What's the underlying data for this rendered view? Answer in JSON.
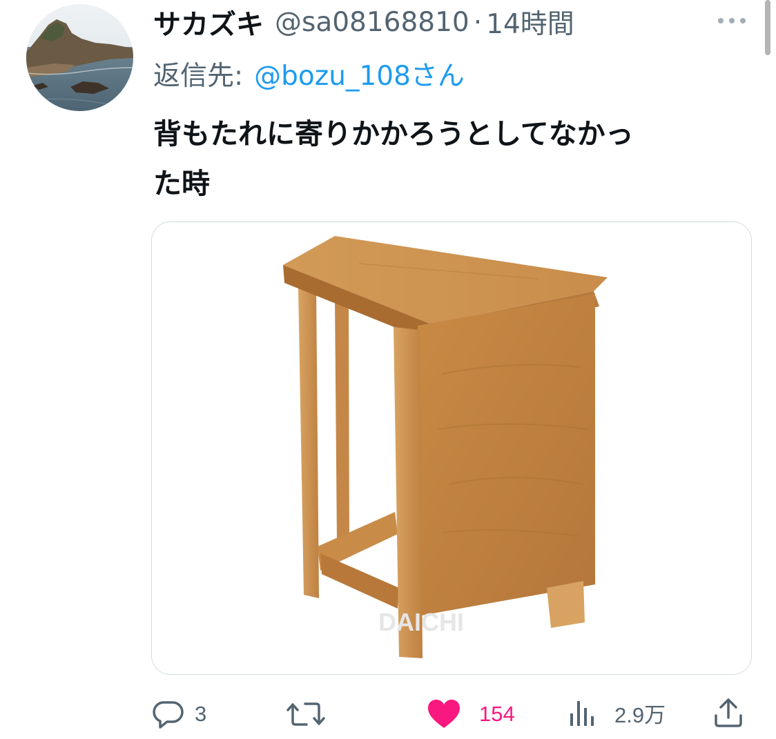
{
  "tweet": {
    "display_name": "サカズキ",
    "handle": "@sa08168810",
    "separator": "·",
    "time": "14時間",
    "reply_label": "返信先:",
    "reply_target": "@bozu_108さん",
    "text_line1": "背もたれに寄りかかろうとしてなかっ",
    "text_line2": "た時",
    "media": {
      "watermark": "DAICHI"
    }
  },
  "actions": {
    "reply_count": "3",
    "retweet_count": "",
    "like_count": "154",
    "views_count": "2.9万"
  },
  "icons": {
    "more": "more-dots-icon",
    "reply": "reply-bubble-icon",
    "retweet": "retweet-arrows-icon",
    "like": "heart-filled-icon",
    "views": "bar-chart-icon",
    "share": "share-upload-icon"
  },
  "colors": {
    "accent_blue": "#1d9bf0",
    "like_pink": "#f91880",
    "secondary_text": "#536471",
    "primary_text": "#0f1419"
  }
}
